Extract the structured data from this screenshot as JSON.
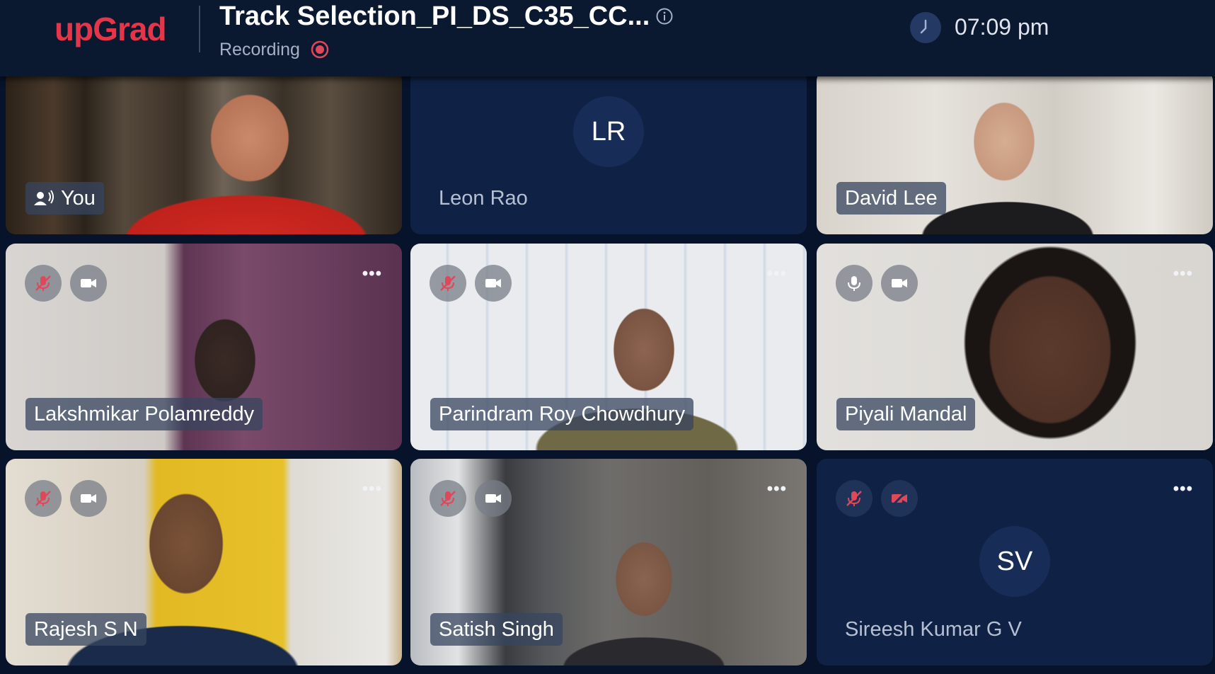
{
  "header": {
    "logo": "upGrad",
    "title": "Track Selection_PI_DS_C35_CC...",
    "recording_label": "Recording",
    "time": "07:09 pm"
  },
  "participants": [
    {
      "name": "You",
      "type": "video",
      "speaking": true
    },
    {
      "name": "Leon Rao",
      "type": "avatar",
      "initials": "LR"
    },
    {
      "name": "David Lee",
      "type": "video"
    },
    {
      "name": "Lakshmikar Polamreddy",
      "type": "video",
      "mic": "muted",
      "camera": "on"
    },
    {
      "name": "Parindram Roy Chowdhury",
      "type": "video",
      "mic": "muted",
      "camera": "on"
    },
    {
      "name": "Piyali Mandal",
      "type": "video",
      "mic": "on",
      "camera": "on"
    },
    {
      "name": "Rajesh S N",
      "type": "video",
      "mic": "muted",
      "camera": "on"
    },
    {
      "name": "Satish Singh",
      "type": "video",
      "mic": "muted",
      "camera": "on"
    },
    {
      "name": "Sireesh Kumar G V",
      "type": "avatar",
      "initials": "SV",
      "mic": "muted",
      "camera": "off"
    }
  ],
  "colors": {
    "brand": "#e43648",
    "background": "#07132b",
    "topbar": "#0a1830",
    "avatar_tile": "#0f2246",
    "muted_icon": "#e0485a"
  },
  "icons": [
    "info-icon",
    "recording-dot-icon",
    "clock-icon",
    "mic-muted-icon",
    "mic-icon",
    "camera-icon",
    "camera-off-icon",
    "more-options-icon",
    "speaker-icon"
  ]
}
